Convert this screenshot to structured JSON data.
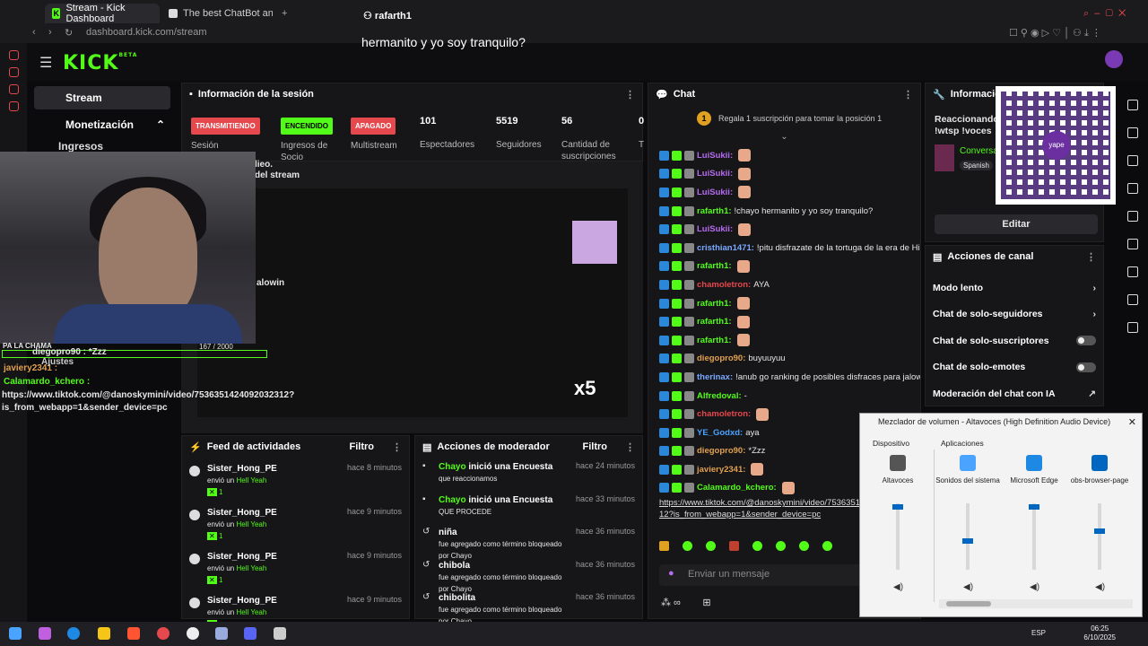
{
  "browser": {
    "tabs": [
      {
        "label": "Stream - Kick Dashboard"
      },
      {
        "label": "The best ChatBot and We"
      }
    ],
    "url": "dashboard.kick.com/stream"
  },
  "top": {
    "username": "rafarth1",
    "caption": "hermanito y yo soy tranquilo?",
    "logo": "KICK",
    "logo_badge": "BETA"
  },
  "nav": {
    "stream": "Stream",
    "monetizacion": "Monetización",
    "ingresos": "Ingresos"
  },
  "session": {
    "title": "Información de la sesión",
    "statuses": [
      {
        "pill": "TRANSMITIENDO",
        "label": "Sesión",
        "color": "#e5484d"
      },
      {
        "pill": "ENCENDIDO",
        "label": "Ingresos de Socio",
        "color": "#53fc18"
      },
      {
        "pill": "APAGADO",
        "label": "Multistream",
        "color": "#e5484d"
      }
    ],
    "stats": [
      {
        "value": "101",
        "label": "Espectadores"
      },
      {
        "value": "5519",
        "label": "Seguidores"
      },
      {
        "value": "56",
        "label": "Cantidad de suscripciones"
      },
      {
        "value": "0",
        "label": "T"
      }
    ]
  },
  "preview": {
    "caption_a": "lieo.",
    "caption_b": "del stream",
    "tag": "alowin",
    "counter": "167 / 2000"
  },
  "overlay": {
    "line1": "PA LA CHAMA",
    "line2": "diegopro90 : *Zzz",
    "line3": "Ajustes",
    "line4": "javiery2341 :",
    "line5": "Calamardo_kchero :",
    "line6": "https://www.tiktok.com/@danoskymini/video/7536351424092032312?",
    "line7": "is_from_webapp=1&sender_device=pc"
  },
  "feed": {
    "title": "Feed de actividades",
    "filter": "Filtro",
    "items": [
      {
        "user": "Sister_Hong_PE",
        "action": "envió un",
        "gift": "Hell Yeah",
        "count": "1",
        "time": "hace 8 minutos"
      },
      {
        "user": "Sister_Hong_PE",
        "action": "envió un",
        "gift": "Hell Yeah",
        "count": "1",
        "time": "hace 9 minutos"
      },
      {
        "user": "Sister_Hong_PE",
        "action": "envió un",
        "gift": "Hell Yeah",
        "count": "1",
        "time": "hace 9 minutos"
      },
      {
        "user": "Sister_Hong_PE",
        "action": "envió un",
        "gift": "Hell Yeah",
        "count": "",
        "time": "hace 9 minutos"
      }
    ]
  },
  "mod": {
    "title": "Acciones de moderador",
    "filter": "Filtro",
    "items": [
      {
        "head": "Chayo",
        "head_rest": " inició una Encuesta",
        "sub": "que reaccionamos",
        "time": "hace 24 minutos"
      },
      {
        "head": "Chayo",
        "head_rest": " inició una Encuesta",
        "sub": "QUE PROCEDE",
        "time": "hace 33 minutos"
      },
      {
        "head": "niña",
        "head_rest": "",
        "sub": "fue agregado como término bloqueado por Chayo",
        "time": "hace 36 minutos"
      },
      {
        "head": "chibola",
        "head_rest": "",
        "sub": "fue agregado como término bloqueado por Chayo",
        "time": "hace 36 minutos"
      },
      {
        "head": "chibolita",
        "head_rest": "",
        "sub": "fue agregado como término bloqueado por Chayo",
        "time": "hace 36 minutos"
      }
    ]
  },
  "chat": {
    "title": "Chat",
    "gift_banner": "Regala 1 suscripción para tomar la posición 1",
    "input_placeholder": "Enviar un mensaje",
    "messages": [
      {
        "user": "LuiSukii:",
        "text": "",
        "color": "#b56cf0"
      },
      {
        "user": "LuiSukii:",
        "text": "",
        "color": "#b56cf0"
      },
      {
        "user": "LuiSukii:",
        "text": "",
        "color": "#b56cf0"
      },
      {
        "user": "rafarth1:",
        "text": "!chayo hermanito y yo soy tranquilo?",
        "color": "#53fc18"
      },
      {
        "user": "LuiSukii:",
        "text": "",
        "color": "#b56cf0"
      },
      {
        "user": "cristhian1471:",
        "text": "!pitu disfrazate de la tortuga de la era de Hielo.",
        "color": "#7aa9ff"
      },
      {
        "user": "rafarth1:",
        "text": "",
        "color": "#53fc18"
      },
      {
        "user": "chamoletron:",
        "text": "AYA",
        "color": "#e5484d"
      },
      {
        "user": "rafarth1:",
        "text": "",
        "color": "#53fc18"
      },
      {
        "user": "rafarth1:",
        "text": "",
        "color": "#53fc18"
      },
      {
        "user": "rafarth1:",
        "text": "",
        "color": "#53fc18"
      },
      {
        "user": "diegopro90:",
        "text": "buyuuyuu",
        "color": "#e0a050"
      },
      {
        "user": "therinax:",
        "text": "!anub go ranking de posibles disfraces para jalowin",
        "color": "#7aa9ff"
      },
      {
        "user": "Alfredoval:",
        "text": "-",
        "color": "#53fc18"
      },
      {
        "user": "chamoletron:",
        "text": "",
        "color": "#e5484d"
      },
      {
        "user": "YE_Godxd:",
        "text": "aya",
        "color": "#4aa3ff"
      },
      {
        "user": "diegopro90:",
        "text": "*Zzz",
        "color": "#e0a050"
      },
      {
        "user": "javiery2341:",
        "text": "",
        "color": "#e0a050"
      },
      {
        "user": "Calamardo_kchero:",
        "text": "",
        "color": "#53fc18"
      }
    ],
    "link1": "https://www.tiktok.com/@danoskymini/video/7536351",
    "link2": "12?is_from_webapp=1&sender_device=pc"
  },
  "info": {
    "title": "Información",
    "line1": "Reaccionando v",
    "line2": "!wtsp !voces",
    "category": "Conversa",
    "lang": "Spanish",
    "edit": "Editar",
    "qr_label": "yape"
  },
  "actions": {
    "title": "Acciones de canal",
    "rows": [
      {
        "label": "Modo lento",
        "kind": "arrow"
      },
      {
        "label": "Chat de solo-seguidores",
        "kind": "arrow"
      },
      {
        "label": "Chat de solo-suscriptores",
        "kind": "toggle"
      },
      {
        "label": "Chat de solo-emotes",
        "kind": "toggle"
      },
      {
        "label": "Moderación del chat con IA",
        "kind": "link"
      }
    ]
  },
  "mixer": {
    "title": "Mezclador de volumen - Altavoces (High Definition Audio Device)",
    "device_label": "Dispositivo",
    "apps_label": "Aplicaciones",
    "channels": [
      {
        "name": "Altavoces",
        "level": 0.98
      },
      {
        "name": "Sonidos del sistema",
        "level": 0.45
      },
      {
        "name": "Microsoft Edge",
        "level": 0.98
      },
      {
        "name": "obs-browser-page",
        "level": 0.6
      }
    ]
  },
  "taskbar": {
    "lang": "ESP",
    "time": "06:25",
    "date": "6/10/2025"
  }
}
